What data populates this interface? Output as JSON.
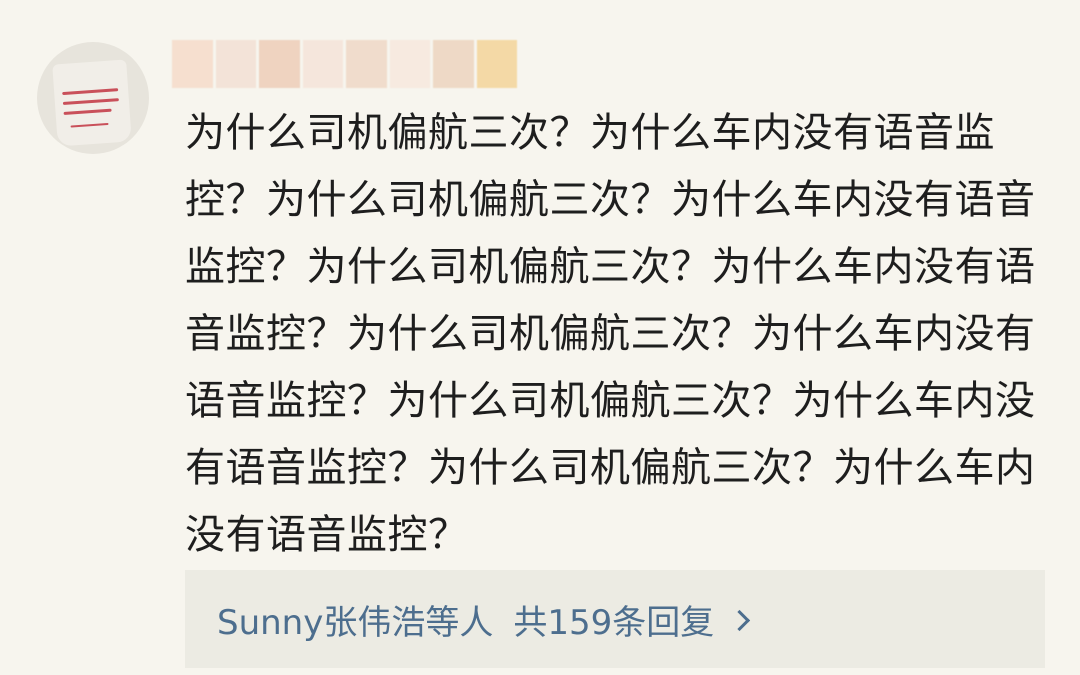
{
  "comment": {
    "text": "为什么司机偏航三次？为什么车内没有语音监控？为什么司机偏航三次？为什么车内没有语音监控？为什么司机偏航三次？为什么车内没有语音监控？为什么司机偏航三次？为什么车内没有语音监控？为什么司机偏航三次？为什么车内没有语音监控？为什么司机偏航三次？为什么车内没有语音监控？"
  },
  "avatar": {
    "icon": "thank-you-bag-avatar"
  },
  "reply": {
    "users": "Sunny张伟浩等人",
    "count": "共159条回复",
    "icon": "chevron-right-icon"
  },
  "colors": {
    "link": "#4d6e8e",
    "text": "#1e1e1e",
    "background": "#f7f5ee",
    "reply_bg": "#ecebe3"
  }
}
